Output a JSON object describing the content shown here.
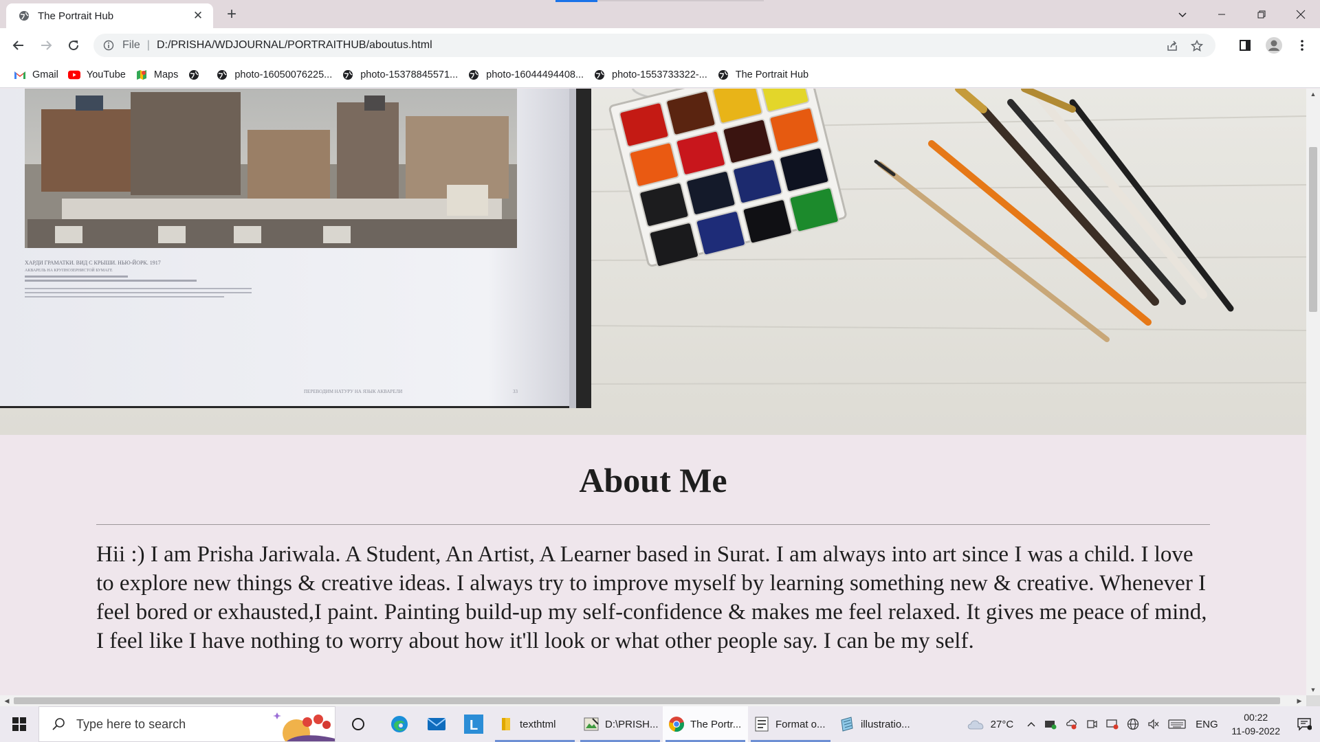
{
  "browser": {
    "tab_title": "The Portrait Hub",
    "url_scheme": "File",
    "url": "D:/PRISHA/WDJOURNAL/PORTRAITHUB/aboutus.html"
  },
  "bookmarks": [
    {
      "label": "Gmail",
      "icon": "gmail-icon"
    },
    {
      "label": "YouTube",
      "icon": "youtube-icon"
    },
    {
      "label": "Maps",
      "icon": "maps-icon"
    },
    {
      "label": "",
      "icon": "globe-icon"
    },
    {
      "label": "photo-16050076225...",
      "icon": "globe-icon"
    },
    {
      "label": "photo-15378845571...",
      "icon": "globe-icon"
    },
    {
      "label": "photo-16044494408...",
      "icon": "globe-icon"
    },
    {
      "label": "photo-1553733322-...",
      "icon": "globe-icon"
    },
    {
      "label": "The Portrait Hub",
      "icon": "globe-icon"
    }
  ],
  "hero_book": {
    "caption_title": "ХАРДИ ГРАМАТКИ. ВИД С КРЫШИ. НЬЮ-ЙОРК. 1917",
    "caption_sub": "АКВАРЕЛЬ НА КРУПНОЗЕРНИСТОЙ БУМАГЕ",
    "footer": "ПЕРЕВОДИМ НАТУРУ НА ЯЗЫК АКВАРЕЛИ",
    "page_number": "33"
  },
  "paint_colors": [
    "#c41a14",
    "#5a2410",
    "#e8b418",
    "#e3d62a",
    "#ea5a12",
    "#c8161c",
    "#3a1410",
    "#e65a10",
    "#1c1c1e",
    "#141a2a",
    "#1c2a6e",
    "#0e1220",
    "#1a1a1c",
    "#1e2c78",
    "#101014",
    "#1c8a2c"
  ],
  "about": {
    "title": "About Me",
    "text": "Hii :) I am Prisha Jariwala. A Student, An Artist, A Learner based in Surat. I am always into art since I was a child. I love to explore new things & creative ideas. I always try to improve myself by learning something new & creative. Whenever I feel bored or exhausted,I paint. Painting build-up my self-confidence & makes me feel relaxed. It gives me peace of mind, I feel like I have nothing to worry about how it'll look or what other people say. I can be my self."
  },
  "taskbar": {
    "search_placeholder": "Type here to search",
    "apps": [
      {
        "label": "texthtml",
        "icon": "folder-icon"
      },
      {
        "label": "D:\\PRISH...",
        "icon": "image-editor-icon"
      },
      {
        "label": "The Portr...",
        "icon": "chrome-icon",
        "active": true
      },
      {
        "label": "Format o...",
        "icon": "document-icon"
      },
      {
        "label": "illustratio...",
        "icon": "notepad-icon"
      }
    ],
    "weather": "27°C",
    "language": "ENG",
    "time": "00:22",
    "date": "11-09-2022"
  }
}
